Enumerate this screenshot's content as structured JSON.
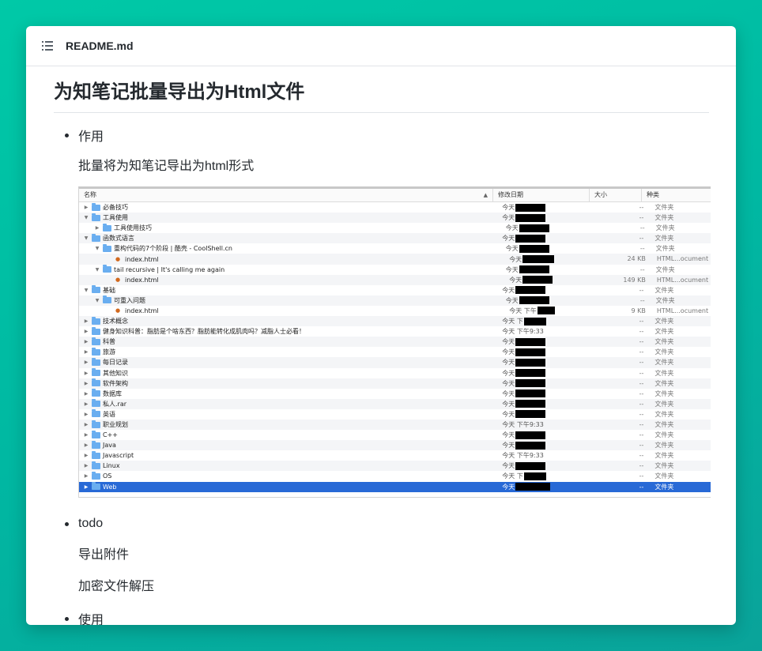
{
  "window": {
    "title": "README.md"
  },
  "doc": {
    "title": "为知笔记批量导出为Html文件",
    "sections": [
      {
        "bullet": "作用",
        "paras": [
          "批量将为知笔记导出为html形式"
        ]
      },
      {
        "bullet": "todo",
        "paras": [
          "导出附件",
          "加密文件解压"
        ]
      },
      {
        "bullet": "使用",
        "paras": []
      }
    ]
  },
  "finder": {
    "columns": {
      "name": "名称",
      "date": "修改日期",
      "size": "大小",
      "kind": "种类"
    },
    "rows": [
      {
        "indent": 0,
        "expand": "▶",
        "icon": "folder",
        "name": "必备技巧",
        "date": "今天",
        "redact": 38,
        "size": "--",
        "kind": "文件夹"
      },
      {
        "indent": 0,
        "expand": "▼",
        "icon": "folder",
        "name": "工具使用",
        "date": "今天",
        "redact": 38,
        "size": "--",
        "kind": "文件夹"
      },
      {
        "indent": 1,
        "expand": "▶",
        "icon": "folder",
        "name": "工具使用技巧",
        "date": "今天",
        "redact": 38,
        "size": "--",
        "kind": "文件夹"
      },
      {
        "indent": 0,
        "expand": "▼",
        "icon": "folder",
        "name": "函数式语言",
        "date": "今天",
        "redact": 38,
        "size": "--",
        "kind": "文件夹"
      },
      {
        "indent": 1,
        "expand": "▼",
        "icon": "folder",
        "name": "重构代码的7个阶段 | 酷壳 - CoolShell.cn",
        "date": "今天",
        "redact": 38,
        "size": "--",
        "kind": "文件夹"
      },
      {
        "indent": 2,
        "expand": "",
        "icon": "html",
        "name": "index.html",
        "date": "今天",
        "redact": 40,
        "size": "24 KB",
        "kind": "HTML...ocument"
      },
      {
        "indent": 1,
        "expand": "▼",
        "icon": "folder",
        "name": "tail recursive | It's calling me again",
        "date": "今天",
        "redact": 38,
        "size": "--",
        "kind": "文件夹"
      },
      {
        "indent": 2,
        "expand": "",
        "icon": "html",
        "name": "index.html",
        "date": "今天",
        "redact": 38,
        "size": "149 KB",
        "kind": "HTML...ocument"
      },
      {
        "indent": 0,
        "expand": "▼",
        "icon": "folder",
        "name": "基础",
        "date": "今天",
        "redact": 38,
        "size": "--",
        "kind": "文件夹"
      },
      {
        "indent": 1,
        "expand": "▼",
        "icon": "folder",
        "name": "可重入问题",
        "date": "今天",
        "redact": 38,
        "size": "--",
        "kind": "文件夹"
      },
      {
        "indent": 2,
        "expand": "",
        "icon": "html",
        "name": "index.html",
        "date": "今天 下午",
        "redact": 22,
        "size": "9 KB",
        "kind": "HTML...ocument"
      },
      {
        "indent": 0,
        "expand": "▶",
        "icon": "folder",
        "name": "技术概念",
        "date": "今天 下",
        "redact": 28,
        "size": "--",
        "kind": "文件夹"
      },
      {
        "indent": 0,
        "expand": "▶",
        "icon": "folder",
        "name": "健身知识科普：脂肪是个啥东西？脂肪能转化成肌肉吗？减脂人士必看！",
        "date": "今天 下午9:33",
        "redact": 0,
        "size": "--",
        "kind": "文件夹"
      },
      {
        "indent": 0,
        "expand": "▶",
        "icon": "folder",
        "name": "科普",
        "date": "今天",
        "redact": 38,
        "size": "--",
        "kind": "文件夹"
      },
      {
        "indent": 0,
        "expand": "▶",
        "icon": "folder",
        "name": "旅游",
        "date": "今天",
        "redact": 38,
        "size": "--",
        "kind": "文件夹"
      },
      {
        "indent": 0,
        "expand": "▶",
        "icon": "folder",
        "name": "每日记录",
        "date": "今天",
        "redact": 38,
        "size": "--",
        "kind": "文件夹"
      },
      {
        "indent": 0,
        "expand": "▶",
        "icon": "folder",
        "name": "其他知识",
        "date": "今天",
        "redact": 38,
        "size": "--",
        "kind": "文件夹"
      },
      {
        "indent": 0,
        "expand": "▶",
        "icon": "folder",
        "name": "软件架构",
        "date": "今天",
        "redact": 38,
        "size": "--",
        "kind": "文件夹"
      },
      {
        "indent": 0,
        "expand": "▶",
        "icon": "folder",
        "name": "数据库",
        "date": "今天",
        "redact": 38,
        "size": "--",
        "kind": "文件夹"
      },
      {
        "indent": 0,
        "expand": "▶",
        "icon": "folder",
        "name": "私人.rar",
        "date": "今天",
        "redact": 38,
        "size": "--",
        "kind": "文件夹"
      },
      {
        "indent": 0,
        "expand": "▶",
        "icon": "folder",
        "name": "英语",
        "date": "今天",
        "redact": 38,
        "size": "--",
        "kind": "文件夹"
      },
      {
        "indent": 0,
        "expand": "▶",
        "icon": "folder",
        "name": "职业规划",
        "date": "今天 下午9:33",
        "redact": 0,
        "size": "--",
        "kind": "文件夹"
      },
      {
        "indent": 0,
        "expand": "▶",
        "icon": "folder",
        "name": "C++",
        "date": "今天",
        "redact": 38,
        "size": "--",
        "kind": "文件夹"
      },
      {
        "indent": 0,
        "expand": "▶",
        "icon": "folder",
        "name": "Java",
        "date": "今天",
        "redact": 38,
        "size": "--",
        "kind": "文件夹"
      },
      {
        "indent": 0,
        "expand": "▶",
        "icon": "folder",
        "name": "Javascript",
        "date": "今天 下午9:33",
        "redact": 0,
        "size": "--",
        "kind": "文件夹"
      },
      {
        "indent": 0,
        "expand": "▶",
        "icon": "folder",
        "name": "Linux",
        "date": "今天",
        "redact": 38,
        "size": "--",
        "kind": "文件夹"
      },
      {
        "indent": 0,
        "expand": "▶",
        "icon": "folder",
        "name": "OS",
        "date": "今天 下",
        "redact": 28,
        "size": "--",
        "kind": "文件夹"
      },
      {
        "indent": 0,
        "expand": "▶",
        "icon": "folder",
        "name": "Web",
        "date": "今天",
        "redact": 44,
        "size": "--",
        "kind": "文件夹",
        "selected": true
      }
    ]
  }
}
